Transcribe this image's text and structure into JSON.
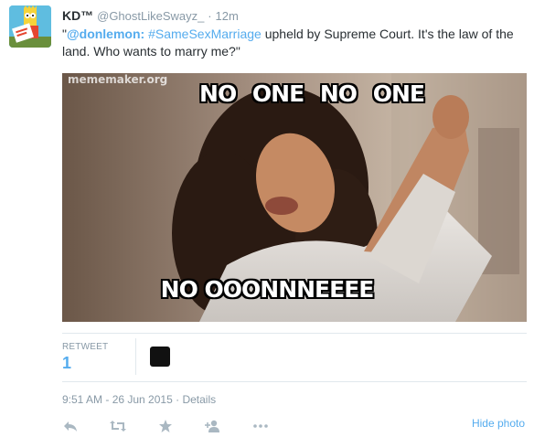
{
  "tweet": {
    "author_name": "KD™",
    "handle": "@GhostLikeSwayz_",
    "separator": "·",
    "time_ago": "12m",
    "text_open_quote": "\"",
    "mention": "@donlemon",
    "mention_colon": ":",
    "hashtag": "#SameSexMarriage",
    "text_rest": " upheld by  Supreme Court. It's the law of the land. Who wants to marry me?\""
  },
  "photo": {
    "watermark": "mememaker.org",
    "top_caption": "NO ONE NO ONE",
    "bottom_caption": "NO OOONNNEEEE"
  },
  "stats": {
    "retweet_label": "RETWEET",
    "retweet_count": "1"
  },
  "meta": {
    "timestamp": "9:51 AM - 26 Jun 2015",
    "separator": "·",
    "details_label": "Details"
  },
  "actions": {
    "hide_photo_label": "Hide photo",
    "icons": [
      "reply-icon",
      "retweet-icon",
      "favorite-icon",
      "follow-icon",
      "more-icon"
    ]
  },
  "colors": {
    "link": "#55acee",
    "muted": "#8899a6",
    "text": "#292f33",
    "divider": "#e1e8ed"
  }
}
